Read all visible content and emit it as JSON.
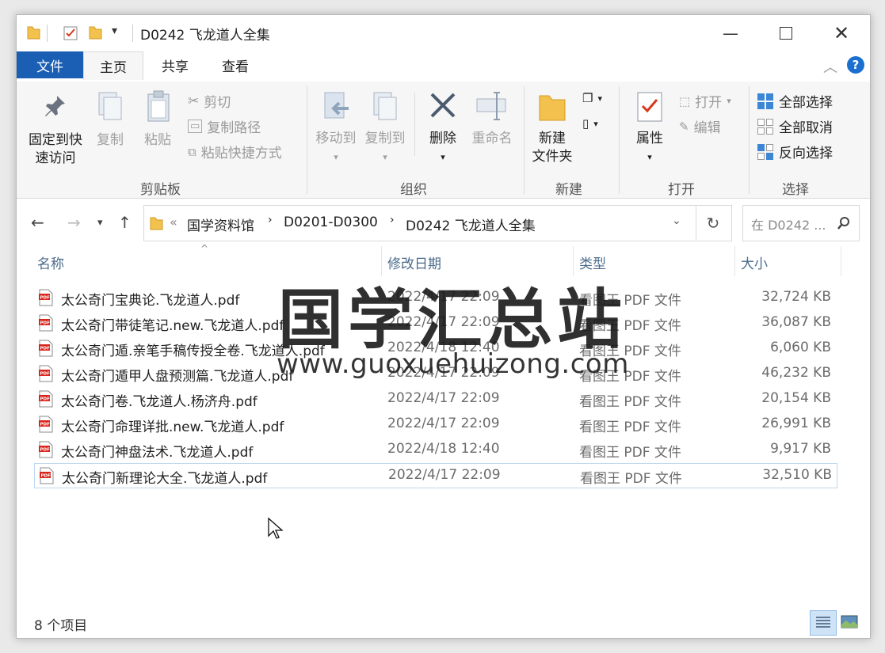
{
  "window": {
    "title": "D0242 飞龙道人全集"
  },
  "tabs": {
    "file": "文件",
    "home": "主页",
    "share": "共享",
    "view": "查看"
  },
  "ribbon": {
    "clipboard": {
      "pin": "固定到快速访问",
      "pin_line1": "固定到快",
      "pin_line2": "速访问",
      "copy": "复制",
      "paste": "粘贴",
      "cut": "剪切",
      "copy_path": "复制路径",
      "paste_shortcut": "粘贴快捷方式",
      "label": "剪贴板"
    },
    "organize": {
      "move_to": "移动到",
      "copy_to": "复制到",
      "delete": "删除",
      "rename": "重命名",
      "label": "组织"
    },
    "new": {
      "new_folder_line1": "新建",
      "new_folder_line2": "文件夹",
      "label": "新建"
    },
    "open": {
      "properties": "属性",
      "open": "打开",
      "edit": "编辑",
      "label": "打开"
    },
    "select": {
      "select_all": "全部选择",
      "select_none": "全部取消",
      "invert": "反向选择",
      "label": "选择"
    }
  },
  "address": {
    "overflow": "«",
    "crumbs": [
      "国学资料馆",
      "D0201-D0300",
      "D0242 飞龙道人全集"
    ],
    "search_placeholder": "在 D0242 ..."
  },
  "columns": {
    "name": "名称",
    "modified": "修改日期",
    "type": "类型",
    "size": "大小"
  },
  "files": [
    {
      "name": "太公奇门宝典论.飞龙道人.pdf",
      "modified": "2022/4/17 22:09",
      "type": "看图王 PDF 文件",
      "size": "32,724 KB"
    },
    {
      "name": "太公奇门带徒笔记.new.飞龙道人.pdf",
      "modified": "2022/4/17 22:09",
      "type": "看图王 PDF 文件",
      "size": "36,087 KB"
    },
    {
      "name": "太公奇门遁.亲笔手稿传授全卷.飞龙道人.pdf",
      "modified": "2022/4/18 12:40",
      "type": "看图王 PDF 文件",
      "size": "6,060 KB"
    },
    {
      "name": "太公奇门遁甲人盘预测篇.飞龙道人.pdf",
      "modified": "2022/4/17 22:09",
      "type": "看图王 PDF 文件",
      "size": "46,232 KB"
    },
    {
      "name": "太公奇门卷.飞龙道人.杨济舟.pdf",
      "modified": "2022/4/17 22:09",
      "type": "看图王 PDF 文件",
      "size": "20,154 KB"
    },
    {
      "name": "太公奇门命理详批.new.飞龙道人.pdf",
      "modified": "2022/4/17 22:09",
      "type": "看图王 PDF 文件",
      "size": "26,991 KB"
    },
    {
      "name": "太公奇门神盘法术.飞龙道人.pdf",
      "modified": "2022/4/18 12:40",
      "type": "看图王 PDF 文件",
      "size": "9,917 KB"
    },
    {
      "name": "太公奇门新理论大全.飞龙道人.pdf",
      "modified": "2022/4/17 22:09",
      "type": "看图王 PDF 文件",
      "size": "32,510 KB"
    }
  ],
  "watermark": {
    "cn": "国学汇总站",
    "url": "www.guoxuehuizong.com"
  },
  "status": {
    "count": "8 个项目"
  },
  "colors": {
    "file_tab": "#1a5fb4",
    "selection_border": "#bcd6ee",
    "folder": "#f2c14e"
  }
}
